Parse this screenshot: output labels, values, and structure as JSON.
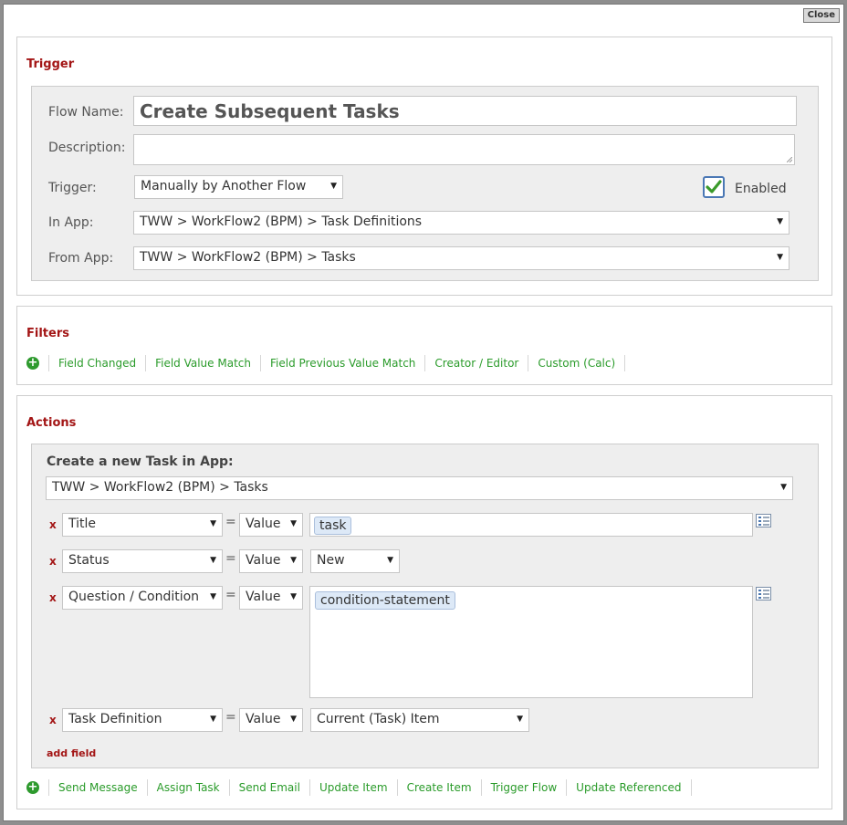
{
  "dialog": {
    "close_label": "Close"
  },
  "trigger": {
    "title": "Trigger",
    "flow_name_label": "Flow Name:",
    "flow_name_value": "Create Subsequent Tasks",
    "description_label": "Description:",
    "description_value": "",
    "trigger_label": "Trigger:",
    "trigger_value": "Manually by Another Flow",
    "enabled_label": "Enabled",
    "enabled": true,
    "in_app_label": "In App:",
    "in_app_value": "TWW > WorkFlow2 (BPM) > Task Definitions",
    "from_app_label": "From App:",
    "from_app_value": "TWW > WorkFlow2 (BPM) > Tasks"
  },
  "filters": {
    "title": "Filters",
    "links": [
      "Field Changed",
      "Field Value Match",
      "Field Previous Value Match",
      "Creator / Editor",
      "Custom (Calc)"
    ]
  },
  "actions": {
    "title": "Actions",
    "create_heading": "Create a new Task in App:",
    "app_value": "TWW > WorkFlow2 (BPM) > Tasks",
    "remove_glyph": "x",
    "equals": "=",
    "fields": [
      {
        "field": "Title",
        "mode": "Value",
        "value": "task"
      },
      {
        "field": "Status",
        "mode": "Value",
        "value": "New"
      },
      {
        "field": "Question / Condition",
        "mode": "Value",
        "value": "condition-statement"
      },
      {
        "field": "Task Definition",
        "mode": "Value",
        "value": "Current (Task) Item"
      }
    ],
    "add_field_label": "add field",
    "links": [
      "Send Message",
      "Assign Task",
      "Send Email",
      "Update Item",
      "Create Item",
      "Trigger Flow",
      "Update Referenced"
    ]
  },
  "icons": {
    "add": "plus-circle-icon",
    "picker": "field-picker-icon",
    "checkbox": "checkmark-icon",
    "dropdown": "dropdown-arrow-icon"
  },
  "colors": {
    "section_title": "#a31515",
    "link": "#2a9b2a",
    "plus_icon": "#2e9a2e",
    "token_bg": "#dde9f7",
    "backdrop": "#8e8e8e"
  }
}
